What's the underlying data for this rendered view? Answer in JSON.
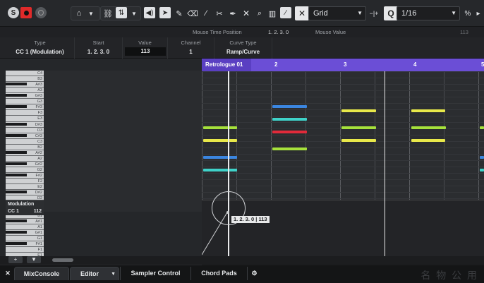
{
  "toolbar": {
    "solo_label": "S",
    "grid_type": "Grid",
    "quantize": "1/16",
    "minus_plus": "−|+",
    "q_label": "Q",
    "pct_label": "%",
    "icons": [
      "solo-icon",
      "record-icon",
      "monitor-icon",
      "home-icon",
      "chevron-down-icon",
      "link-icon",
      "transpose-icon",
      "chevron-down-icon",
      "speaker-icon",
      "arrow-icon",
      "pencil-icon",
      "eraser-icon",
      "draw-line-icon",
      "scissors-icon",
      "glue-icon",
      "mute-x-icon",
      "zoom-icon",
      "velocity-icon",
      "line-tool-icon",
      "snap-icon",
      "quantize-icon",
      "percent-icon"
    ]
  },
  "infoline": {
    "mouse_time_label": "Mouse Time Position",
    "mouse_time_value": "1. 2. 3.   0",
    "mouse_value_label": "Mouse Value",
    "mouse_value_value": "113"
  },
  "event": {
    "type_label": "Type",
    "type_value": "CC 1 (Modulation)",
    "start_label": "Start",
    "start_value": "1. 2. 3.   0",
    "value_label": "Value",
    "value_value": "113",
    "channel_label": "Channel",
    "channel_value": "1",
    "curve_label": "Curve Type",
    "curve_value": "Ramp/Curve"
  },
  "part": {
    "name": "Retrologue 01",
    "bar2": "2",
    "bar3": "3",
    "bar4": "4",
    "bar5": "5"
  },
  "keys": [
    "C4",
    "B3",
    "A#3",
    "A3",
    "G#3",
    "G3",
    "F#3",
    "F3",
    "E3",
    "D#3",
    "D3",
    "C#3",
    "C3",
    "B2",
    "A#2",
    "A2",
    "G#2",
    "G2",
    "F#2",
    "F2",
    "E2",
    "D#2",
    "D2",
    "C#2",
    "C2",
    "B1",
    "A#1",
    "A1",
    "G#1",
    "G1",
    "F#1",
    "F1",
    "E1"
  ],
  "controller": {
    "name": "Modulation",
    "cc": "CC 1",
    "value": "112"
  },
  "tooltip": "1. 2. 3.   0 | 113",
  "tabs": {
    "close": "✕",
    "mixconsole": "MixConsole",
    "editor": "Editor",
    "sampler": "Sampler Control",
    "chordpads": "Chord Pads",
    "gear": "⚙"
  },
  "lane_add": "+",
  "lane_menu": "▼",
  "watermark": "名 物 公 用",
  "colors": {
    "part": "#6b4ed6",
    "note_green": "#a6e13b",
    "note_yellow": "#e8e84a",
    "note_cyan": "#3fd2c9",
    "note_blue": "#3b86e0",
    "note_red": "#e02a3a",
    "record": "#e02a2a"
  }
}
